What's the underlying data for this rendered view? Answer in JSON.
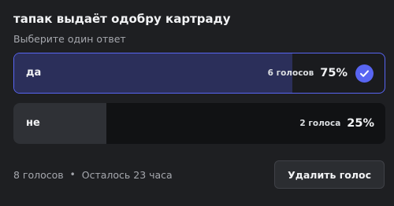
{
  "poll": {
    "question": "тапак выдаёт одобру картраду",
    "hint": "Выберите один ответ",
    "answers": [
      {
        "label": "да",
        "votes": "6 голосов",
        "percent": "75%",
        "share": 0.75,
        "selected": true
      },
      {
        "label": "не",
        "votes": "2 голоса",
        "percent": "25%",
        "share": 0.25,
        "selected": false
      }
    ],
    "total_votes": "8 голосов",
    "separator": "•",
    "time_left": "Осталось 23 часа",
    "remove_vote_label": "Удалить голос"
  },
  "colors": {
    "accent": "#5865f2",
    "background": "#1e1f22",
    "answer_bg": "#111214",
    "selected_fill": "#2b2f5a",
    "unselected_fill": "#2f3136"
  },
  "icons": {
    "selected_answer": "checkmark-circle-icon"
  }
}
